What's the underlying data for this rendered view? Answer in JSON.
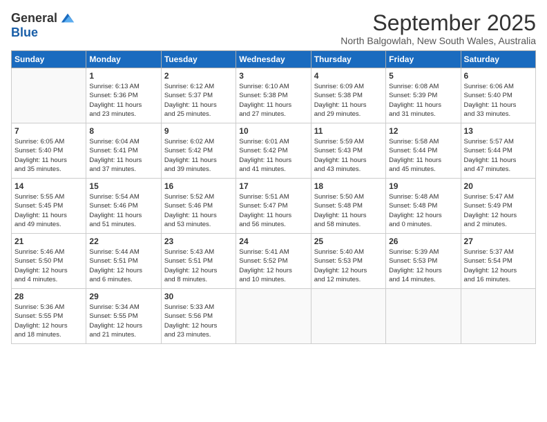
{
  "logo": {
    "general": "General",
    "blue": "Blue"
  },
  "title": "September 2025",
  "location": "North Balgowlah, New South Wales, Australia",
  "weekdays": [
    "Sunday",
    "Monday",
    "Tuesday",
    "Wednesday",
    "Thursday",
    "Friday",
    "Saturday"
  ],
  "weeks": [
    [
      {
        "day": "",
        "info": ""
      },
      {
        "day": "1",
        "info": "Sunrise: 6:13 AM\nSunset: 5:36 PM\nDaylight: 11 hours\nand 23 minutes."
      },
      {
        "day": "2",
        "info": "Sunrise: 6:12 AM\nSunset: 5:37 PM\nDaylight: 11 hours\nand 25 minutes."
      },
      {
        "day": "3",
        "info": "Sunrise: 6:10 AM\nSunset: 5:38 PM\nDaylight: 11 hours\nand 27 minutes."
      },
      {
        "day": "4",
        "info": "Sunrise: 6:09 AM\nSunset: 5:38 PM\nDaylight: 11 hours\nand 29 minutes."
      },
      {
        "day": "5",
        "info": "Sunrise: 6:08 AM\nSunset: 5:39 PM\nDaylight: 11 hours\nand 31 minutes."
      },
      {
        "day": "6",
        "info": "Sunrise: 6:06 AM\nSunset: 5:40 PM\nDaylight: 11 hours\nand 33 minutes."
      }
    ],
    [
      {
        "day": "7",
        "info": "Sunrise: 6:05 AM\nSunset: 5:40 PM\nDaylight: 11 hours\nand 35 minutes."
      },
      {
        "day": "8",
        "info": "Sunrise: 6:04 AM\nSunset: 5:41 PM\nDaylight: 11 hours\nand 37 minutes."
      },
      {
        "day": "9",
        "info": "Sunrise: 6:02 AM\nSunset: 5:42 PM\nDaylight: 11 hours\nand 39 minutes."
      },
      {
        "day": "10",
        "info": "Sunrise: 6:01 AM\nSunset: 5:42 PM\nDaylight: 11 hours\nand 41 minutes."
      },
      {
        "day": "11",
        "info": "Sunrise: 5:59 AM\nSunset: 5:43 PM\nDaylight: 11 hours\nand 43 minutes."
      },
      {
        "day": "12",
        "info": "Sunrise: 5:58 AM\nSunset: 5:44 PM\nDaylight: 11 hours\nand 45 minutes."
      },
      {
        "day": "13",
        "info": "Sunrise: 5:57 AM\nSunset: 5:44 PM\nDaylight: 11 hours\nand 47 minutes."
      }
    ],
    [
      {
        "day": "14",
        "info": "Sunrise: 5:55 AM\nSunset: 5:45 PM\nDaylight: 11 hours\nand 49 minutes."
      },
      {
        "day": "15",
        "info": "Sunrise: 5:54 AM\nSunset: 5:46 PM\nDaylight: 11 hours\nand 51 minutes."
      },
      {
        "day": "16",
        "info": "Sunrise: 5:52 AM\nSunset: 5:46 PM\nDaylight: 11 hours\nand 53 minutes."
      },
      {
        "day": "17",
        "info": "Sunrise: 5:51 AM\nSunset: 5:47 PM\nDaylight: 11 hours\nand 56 minutes."
      },
      {
        "day": "18",
        "info": "Sunrise: 5:50 AM\nSunset: 5:48 PM\nDaylight: 11 hours\nand 58 minutes."
      },
      {
        "day": "19",
        "info": "Sunrise: 5:48 AM\nSunset: 5:48 PM\nDaylight: 12 hours\nand 0 minutes."
      },
      {
        "day": "20",
        "info": "Sunrise: 5:47 AM\nSunset: 5:49 PM\nDaylight: 12 hours\nand 2 minutes."
      }
    ],
    [
      {
        "day": "21",
        "info": "Sunrise: 5:46 AM\nSunset: 5:50 PM\nDaylight: 12 hours\nand 4 minutes."
      },
      {
        "day": "22",
        "info": "Sunrise: 5:44 AM\nSunset: 5:51 PM\nDaylight: 12 hours\nand 6 minutes."
      },
      {
        "day": "23",
        "info": "Sunrise: 5:43 AM\nSunset: 5:51 PM\nDaylight: 12 hours\nand 8 minutes."
      },
      {
        "day": "24",
        "info": "Sunrise: 5:41 AM\nSunset: 5:52 PM\nDaylight: 12 hours\nand 10 minutes."
      },
      {
        "day": "25",
        "info": "Sunrise: 5:40 AM\nSunset: 5:53 PM\nDaylight: 12 hours\nand 12 minutes."
      },
      {
        "day": "26",
        "info": "Sunrise: 5:39 AM\nSunset: 5:53 PM\nDaylight: 12 hours\nand 14 minutes."
      },
      {
        "day": "27",
        "info": "Sunrise: 5:37 AM\nSunset: 5:54 PM\nDaylight: 12 hours\nand 16 minutes."
      }
    ],
    [
      {
        "day": "28",
        "info": "Sunrise: 5:36 AM\nSunset: 5:55 PM\nDaylight: 12 hours\nand 18 minutes."
      },
      {
        "day": "29",
        "info": "Sunrise: 5:34 AM\nSunset: 5:55 PM\nDaylight: 12 hours\nand 21 minutes."
      },
      {
        "day": "30",
        "info": "Sunrise: 5:33 AM\nSunset: 5:56 PM\nDaylight: 12 hours\nand 23 minutes."
      },
      {
        "day": "",
        "info": ""
      },
      {
        "day": "",
        "info": ""
      },
      {
        "day": "",
        "info": ""
      },
      {
        "day": "",
        "info": ""
      }
    ]
  ]
}
